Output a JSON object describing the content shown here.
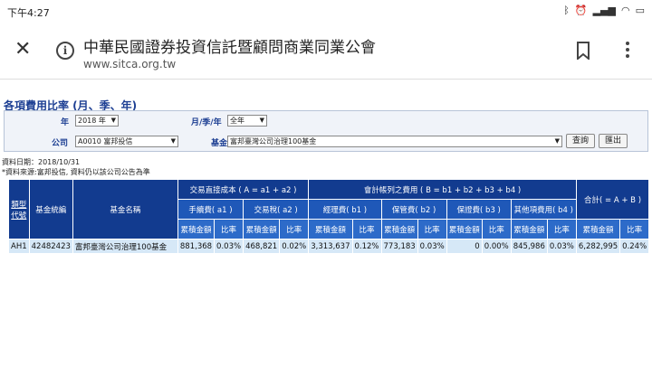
{
  "status": {
    "time": "下午4:27",
    "icons": [
      "bluetooth-icon",
      "alarm-icon",
      "signal-icon",
      "wifi-icon",
      "battery-icon"
    ]
  },
  "browser": {
    "title": "中華民國證券投資信託暨顧問商業同業公會",
    "url": "www.sitca.org.tw"
  },
  "page": {
    "section_title": "各項費用比率 (月、季、年)",
    "filters": {
      "year_label": "年",
      "year_value": "2018 年",
      "period_label": "月/季/年",
      "period_value": "全年",
      "company_label": "公司",
      "company_value": "A0010 富邦投信",
      "fund_label": "基金",
      "fund_value": "富邦臺灣公司治理100基金",
      "query_button": "查詢",
      "export_button": "匯出"
    },
    "data_date": "資料日期：2018/10/31",
    "data_source": "*資料來源:富邦投信, 資料仍以該公司公告為準"
  },
  "table": {
    "headers": {
      "category": "類型代號",
      "fund_code": "基金統編",
      "fund_name": "基金名稱",
      "direct_cost": "交易直接成本 ( A = a1 + a2 )",
      "account_fees": "會計帳列之費用 ( B = b1 + b2 + b3 + b4 )",
      "total": "合計( = A + B )",
      "fee_a1": "手續費( a1 )",
      "tax_a2": "交易稅( a2 )",
      "mgmt_b1": "經理費( b1 )",
      "custody_b2": "保管費( b2 )",
      "guarantee_b3": "保證費( b3 )",
      "other_b4": "其他項費用( b4 )",
      "amount": "累積金額",
      "ratio": "比率"
    },
    "row": {
      "category": "AH1",
      "fund_code": "42482423",
      "fund_name": "富邦臺灣公司治理100基金",
      "a1_amount": "881,368",
      "a1_ratio": "0.03%",
      "a2_amount": "468,821",
      "a2_ratio": "0.02%",
      "b1_amount": "3,313,637",
      "b1_ratio": "0.12%",
      "b2_amount": "773,183",
      "b2_ratio": "0.03%",
      "b3_amount": "0",
      "b3_ratio": "0.00%",
      "b4_amount": "845,986",
      "b4_ratio": "0.03%",
      "total_amount": "6,282,995",
      "total_ratio": "0.24%"
    }
  }
}
